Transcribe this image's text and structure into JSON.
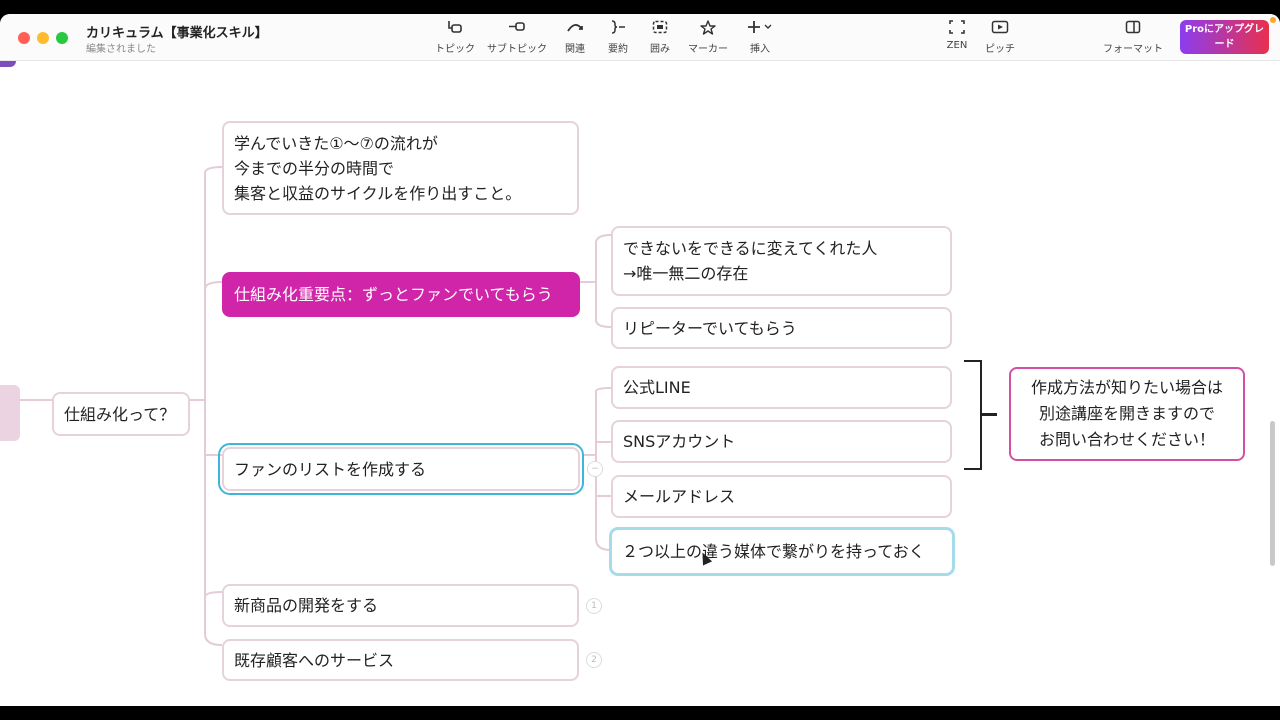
{
  "window": {
    "title": "カリキュラム【事業化スキル】",
    "subtitle": "編集されました"
  },
  "toolbar": {
    "items": [
      {
        "label": "トピック",
        "icon": "topic-icon"
      },
      {
        "label": "サブトピック",
        "icon": "subtopic-icon"
      },
      {
        "label": "関連",
        "icon": "relationship-icon"
      },
      {
        "label": "要約",
        "icon": "summary-icon"
      },
      {
        "label": "囲み",
        "icon": "boundary-icon"
      },
      {
        "label": "マーカー",
        "icon": "marker-icon"
      },
      {
        "label": "挿入",
        "icon": "insert-icon"
      }
    ],
    "zen_label": "ZEN",
    "pitch_label": "ピッチ",
    "format_label": "フォーマット",
    "pro_label": "Proにアップグレード"
  },
  "mindmap": {
    "central": "仕組み化って？",
    "branches": {
      "b1": "学んでいきた①〜⑦の流れが\n今までの半分の時間で\n集客と収益のサイクルを作り出すこと。",
      "b2": "仕組み化重要点：ずっとファンでいてもらう",
      "b2_c1": "できないをできるに変えてくれた人\n→唯一無二の存在",
      "b2_c2": "リピーターでいてもらう",
      "b3": "ファンのリストを作成する",
      "b3_c1": "公式LINE",
      "b3_c2": "SNSアカウント",
      "b3_c3": "メールアドレス",
      "b3_c4": "２つ以上の違う媒体で繋がりを持っておく",
      "b4": "新商品の開発をする",
      "b4_count": "1",
      "b5": "既存顧客へのサービス",
      "b5_count": "2",
      "callout": "作成方法が知りたい場合は\n別途講座を開きますので\nお問い合わせください！"
    }
  },
  "colors": {
    "accent_magenta": "#d024a9",
    "selection_blue": "#3fb6d9",
    "node_border": "#e6d2dd",
    "connector": "#e3cbd7"
  }
}
